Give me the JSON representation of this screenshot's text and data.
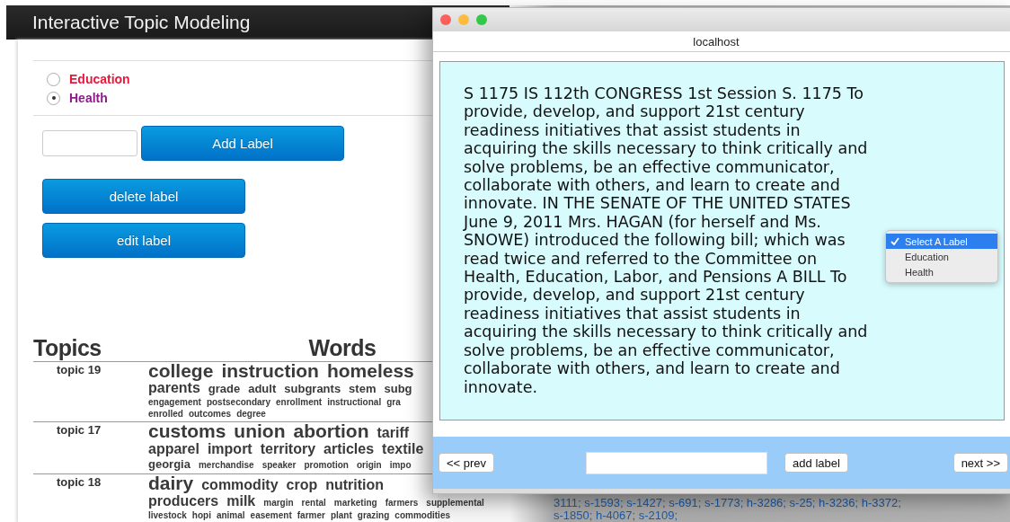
{
  "app": {
    "title": "Interactive Topic Modeling"
  },
  "labels": [
    {
      "name": "Education",
      "color": "#e8173c",
      "selected": false
    },
    {
      "name": "Health",
      "color": "#8e1a8e",
      "selected": true
    }
  ],
  "buttons": {
    "add": "Add Label",
    "delete": "delete label",
    "edit": "edit label"
  },
  "topics_table": {
    "columns": [
      "Topics",
      "Words"
    ],
    "rows": [
      {
        "topic": "topic 19",
        "lines": [
          [
            {
              "word": "college",
              "kind": "large"
            },
            {
              "word": "instruction",
              "kind": "large"
            },
            {
              "word": "homeless",
              "kind": "large"
            }
          ],
          [
            {
              "word": "parents",
              "kind": "medium"
            },
            {
              "word": "grade",
              "kind": "regular"
            },
            {
              "word": "adult",
              "kind": "regular"
            },
            {
              "word": "subgrants",
              "kind": "regular"
            },
            {
              "word": "stem",
              "kind": "regular"
            },
            {
              "word": "subg",
              "kind": "regular"
            }
          ],
          [
            {
              "word": "engagement",
              "kind": "small"
            },
            {
              "word": "postsecondary",
              "kind": "small"
            },
            {
              "word": "enrollment",
              "kind": "small"
            },
            {
              "word": "instructional",
              "kind": "small"
            },
            {
              "word": "gra",
              "kind": "small"
            }
          ],
          [
            {
              "word": "enrolled",
              "kind": "small"
            },
            {
              "word": "outcomes",
              "kind": "small"
            },
            {
              "word": "degree",
              "kind": "small"
            }
          ]
        ]
      },
      {
        "topic": "topic 17",
        "lines": [
          [
            {
              "word": "customs",
              "kind": "large"
            },
            {
              "word": "union",
              "kind": "large"
            },
            {
              "word": "abortion",
              "kind": "large"
            },
            {
              "word": "tariff",
              "kind": "medium"
            }
          ],
          [
            {
              "word": "apparel",
              "kind": "medium"
            },
            {
              "word": "import",
              "kind": "medium"
            },
            {
              "word": "territory",
              "kind": "medium"
            },
            {
              "word": "articles",
              "kind": "medium"
            },
            {
              "word": "textile",
              "kind": "medium"
            }
          ],
          [
            {
              "word": "georgia",
              "kind": "regular"
            },
            {
              "word": "merchandise",
              "kind": "small"
            },
            {
              "word": "speaker",
              "kind": "small"
            },
            {
              "word": "promotion",
              "kind": "small"
            },
            {
              "word": "origin",
              "kind": "small"
            },
            {
              "word": "impo",
              "kind": "small"
            }
          ]
        ]
      },
      {
        "topic": "topic 18",
        "lines": [
          [
            {
              "word": "dairy",
              "kind": "large"
            },
            {
              "word": "commodity",
              "kind": "medium"
            },
            {
              "word": "crop",
              "kind": "medium"
            },
            {
              "word": "nutrition",
              "kind": "medium"
            }
          ],
          [
            {
              "word": "producers",
              "kind": "medium"
            },
            {
              "word": "milk",
              "kind": "medium"
            },
            {
              "word": "margin",
              "kind": "small"
            },
            {
              "word": "rental",
              "kind": "small"
            },
            {
              "word": "marketing",
              "kind": "small"
            },
            {
              "word": "farmers",
              "kind": "small"
            },
            {
              "word": "supplemental",
              "kind": "small"
            }
          ],
          [
            {
              "word": "livestock",
              "kind": "small"
            },
            {
              "word": "hopi",
              "kind": "small"
            },
            {
              "word": "animal",
              "kind": "small"
            },
            {
              "word": "easement",
              "kind": "small"
            },
            {
              "word": "farmer",
              "kind": "small"
            },
            {
              "word": "plant",
              "kind": "small"
            },
            {
              "word": "grazing",
              "kind": "small"
            },
            {
              "word": "commodities",
              "kind": "small"
            }
          ]
        ]
      }
    ]
  },
  "references": [
    "3111; s-1593; s-1427; s-691; s-1773; h-3286; s-25; h-3236; h-3372;",
    "s-1850; h-4067; s-2109;"
  ],
  "popup": {
    "address": "localhost",
    "document": "S 1175 IS 112th CONGRESS 1st Session S. 1175 To provide, develop, and support 21st century readiness initiatives that assist students in acquiring the skills necessary to think critically and solve problems, be an effective communicator, collaborate with others, and learn to create and innovate. IN THE SENATE OF THE UNITED STATES June 9, 2011 Mrs. HAGAN (for herself and Ms. SNOWE) introduced the following bill; which was read twice and referred to the Committee on Health, Education, Labor, and Pensions A BILL To provide, develop, and support 21st century readiness initiatives that assist students in acquiring the skills necessary to think critically and solve problems, be an effective communicator, collaborate with others, and learn to create and innovate.",
    "label_menu": [
      {
        "label": "Select A Label",
        "selected": true
      },
      {
        "label": "Education",
        "selected": false
      },
      {
        "label": "Health",
        "selected": false
      }
    ],
    "prev": "<< prev",
    "add": "add label",
    "next": "next >>"
  }
}
